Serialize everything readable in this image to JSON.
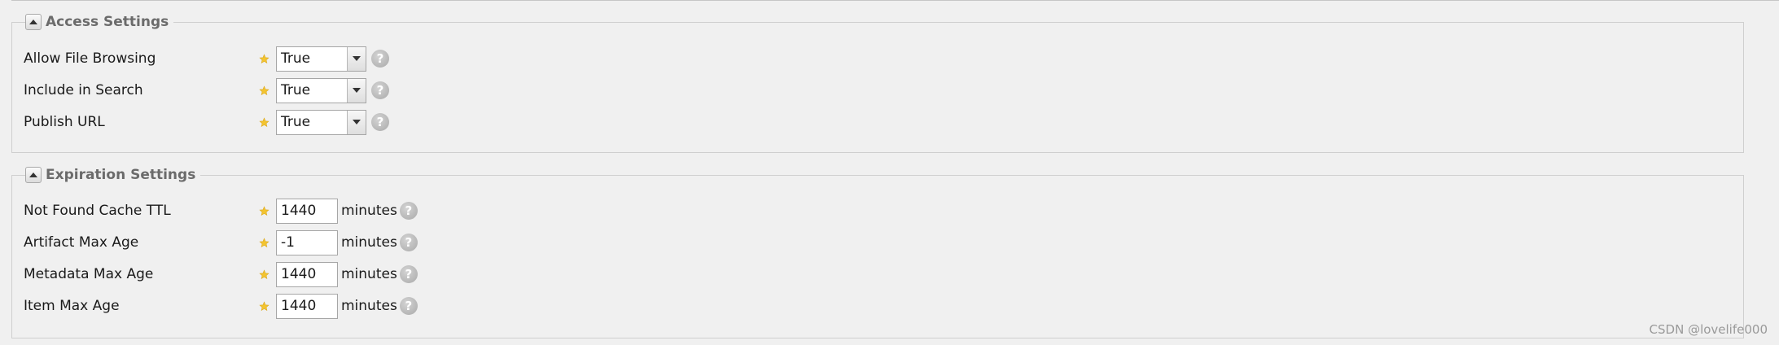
{
  "access_settings": {
    "title": "Access Settings",
    "rows": [
      {
        "label": "Allow File Browsing",
        "value": "True"
      },
      {
        "label": "Include in Search",
        "value": "True"
      },
      {
        "label": "Publish URL",
        "value": "True"
      }
    ]
  },
  "expiration_settings": {
    "title": "Expiration Settings",
    "unit": "minutes",
    "rows": [
      {
        "label": "Not Found Cache TTL",
        "value": "1440"
      },
      {
        "label": "Artifact Max Age",
        "value": "-1"
      },
      {
        "label": "Metadata Max Age",
        "value": "1440"
      },
      {
        "label": "Item Max Age",
        "value": "1440"
      }
    ]
  },
  "icons": {
    "collapse": "triangle-up-icon",
    "required": "star-icon",
    "help": "question-icon",
    "dropdown": "chevron-down-icon"
  },
  "help_glyph": "?",
  "watermark": "CSDN @lovelife000",
  "colors": {
    "required_star": "#f3c431",
    "help_icon": "#b3b3b3",
    "legend_text": "#6b6b6b"
  }
}
